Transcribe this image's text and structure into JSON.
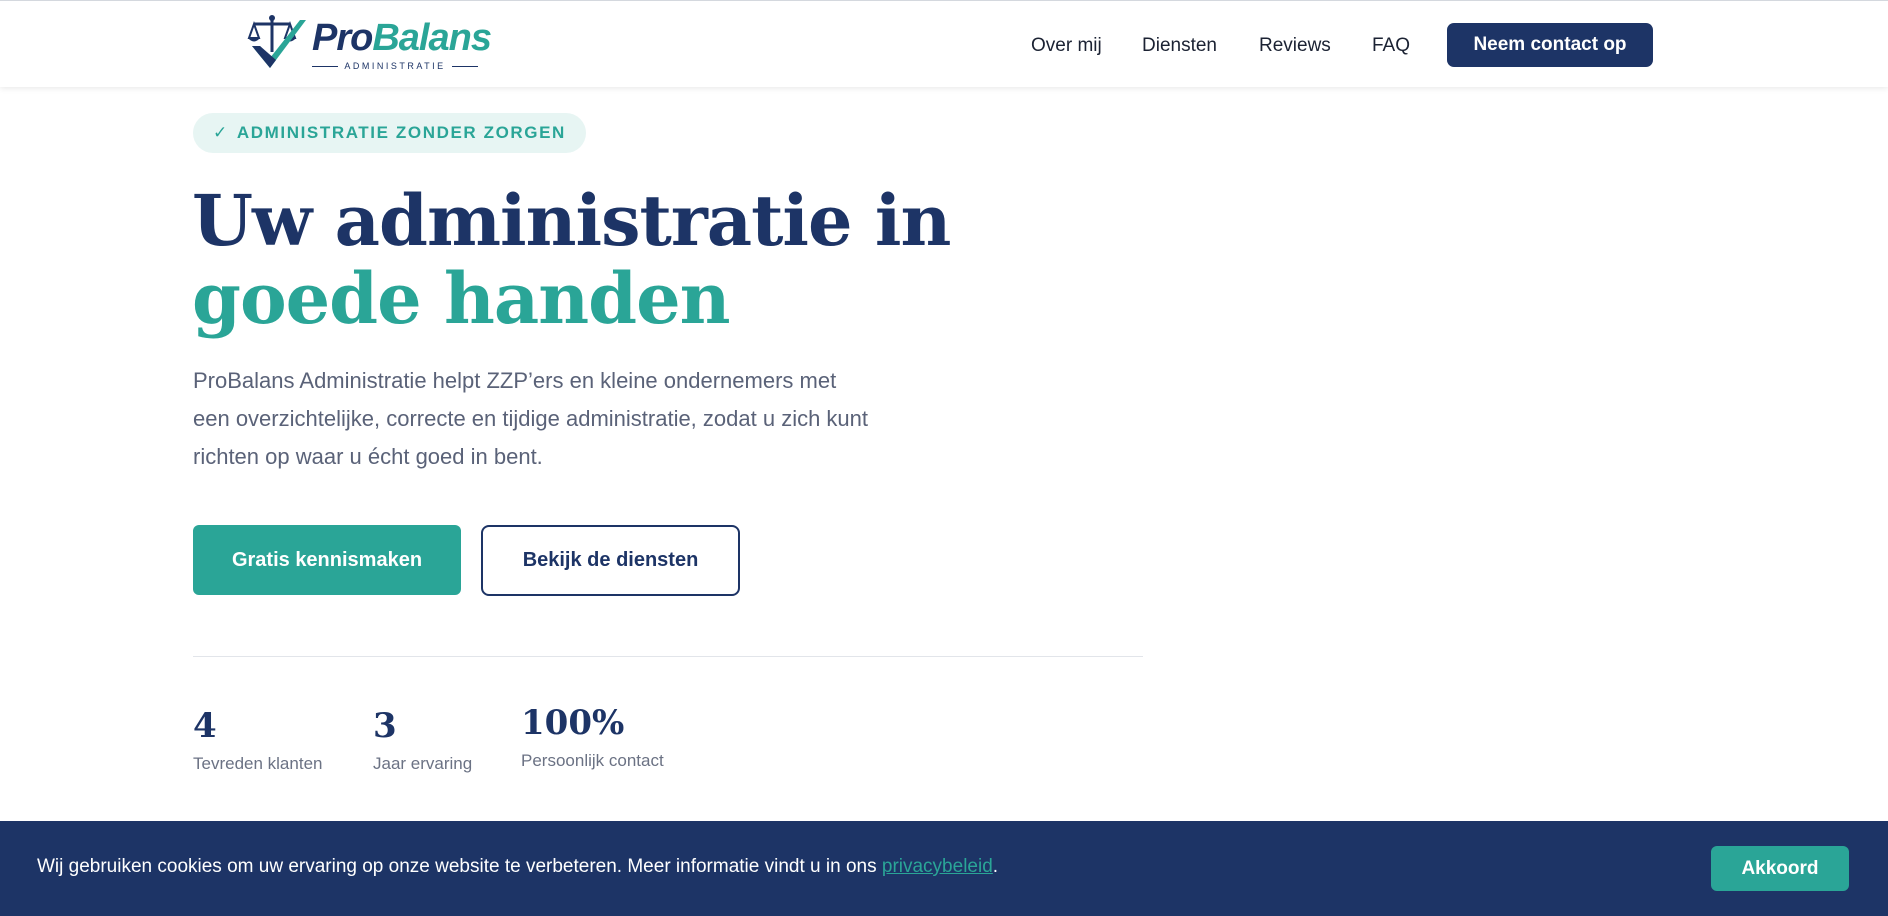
{
  "brand": {
    "name_part1": "Pro",
    "name_part2": "Balans",
    "tagline": "ADMINISTRATIE",
    "logo_icon": "scales-check-icon",
    "colors": {
      "navy": "#1d3466",
      "teal": "#2aa597"
    }
  },
  "nav": {
    "items": [
      {
        "label": "Over mij"
      },
      {
        "label": "Diensten"
      },
      {
        "label": "Reviews"
      },
      {
        "label": "FAQ"
      }
    ],
    "cta_label": "Neem contact op"
  },
  "hero": {
    "badge_icon": "check-icon",
    "badge_check": "✓",
    "badge_label": "ADMINISTRATIE ZONDER ZORGEN",
    "title_part1": "Uw administratie in ",
    "title_accent": "goede handen",
    "description": "ProBalans Administratie helpt ZZP’ers en kleine ondernemers met een overzichtelijke, correcte en tijdige administratie, zodat u zich kunt richten op waar u écht goed in bent.",
    "primary_button": "Gratis kennismaken",
    "secondary_button": "Bekijk de diensten"
  },
  "stats": [
    {
      "value": "4",
      "label": "Tevreden klanten"
    },
    {
      "value": "3",
      "label": "Jaar ervaring"
    },
    {
      "value": "100%",
      "label": "Persoonlijk contact"
    }
  ],
  "cookie": {
    "text": "Wij gebruiken cookies om uw ervaring op onze website te verbeteren. Meer informatie vindt u in ons ",
    "link": "privacybeleid",
    "after": ".",
    "button": "Akkoord"
  }
}
